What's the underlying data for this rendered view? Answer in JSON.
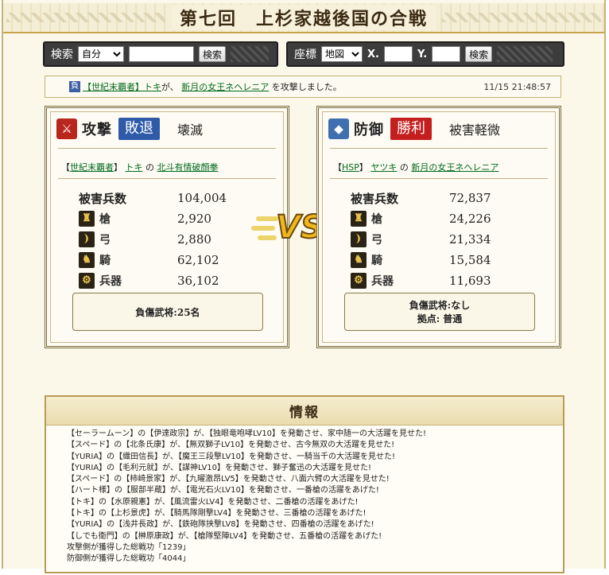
{
  "title": "第七回　上杉家越後国の合戦",
  "search": {
    "label": "検索",
    "select_value": "自分",
    "input_value": "",
    "button": "検索"
  },
  "coord": {
    "label": "座標",
    "select_value": "地図",
    "x_label": "X.",
    "y_label": "Y.",
    "x_value": "",
    "y_value": "",
    "button": "検索"
  },
  "log": {
    "badge": "負",
    "alliance": "【世紀末覇者】",
    "player": "トキ",
    "particle1": "が、",
    "target": "新月の女王ネヘレニア",
    "tail": "を攻撃しました。",
    "timestamp": "11/15 21:48:57"
  },
  "attack": {
    "icon": "⚔",
    "role": "攻撃",
    "result": "敗退",
    "damage": "壊滅",
    "alliance_open": "【",
    "alliance": "世紀末覇者",
    "alliance_close": "】",
    "player": "トキ",
    "particle": "の",
    "general": "北斗有情破顔拳",
    "total_label": "被害兵数",
    "total": "104,004",
    "units": [
      {
        "name": "槍",
        "icon": "spear-icon",
        "value": "2,920"
      },
      {
        "name": "弓",
        "icon": "bow-icon",
        "value": "2,880"
      },
      {
        "name": "騎",
        "icon": "horse-icon",
        "value": "62,102"
      },
      {
        "name": "兵器",
        "icon": "siege-weapon-icon",
        "value": "36,102"
      }
    ],
    "injured": "負傷武将:25名",
    "base": ""
  },
  "defense": {
    "icon": "◆",
    "role": "防御",
    "result": "勝利",
    "damage": "被害軽微",
    "alliance_open": "【",
    "alliance": "HSP",
    "alliance_close": "】",
    "player": "ヤツキ",
    "particle": "の",
    "general": "新月の女王ネヘレニア",
    "total_label": "被害兵数",
    "total": "72,837",
    "units": [
      {
        "name": "槍",
        "icon": "spear-icon",
        "value": "24,226"
      },
      {
        "name": "弓",
        "icon": "bow-icon",
        "value": "21,334"
      },
      {
        "name": "騎",
        "icon": "horse-icon",
        "value": "15,584"
      },
      {
        "name": "兵器",
        "icon": "siege-weapon-icon",
        "value": "11,693"
      }
    ],
    "injured": "負傷武将:なし",
    "base": "拠点: 普通"
  },
  "vs": "VS",
  "info": {
    "title": "情報",
    "lines": [
      "【セーラームーン】の【伊達政宗】が、【独眼竜咆哮LV10】を発動させ、家中随一の大活躍を見せた!",
      "【スペード】の【北条氏康】が、【無双獅子LV10】を発動させ、古今無双の大活躍を見せた!",
      "【YURIA】の【織田信長】が、【魔王三段撃LV10】を発動させ、一騎当千の大活躍を見せた!",
      "【YURIA】の【毛利元就】が、【謀神LV10】を発動させ、獅子奮迅の大活躍を見せた!",
      "【スペード】の【柿崎景家】が、【九曜激昂LV5】を発動させ、八面六臂の大活躍を見せた!",
      "【ハート様】の【服部半蔵】が、【電光石火LV10】を発動させ、一番槍の活躍をあげた!",
      "【トキ】の【水原親憲】が、【風流雷火LV4】を発動させ、二番槍の活躍をあげた!",
      "【トキ】の【上杉景虎】が、【騎馬隊剛撃LV4】を発動させ、三番槍の活躍をあげた!",
      "【YURIA】の【浅井長政】が、【鉄砲隊挟撃LV8】を発動させ、四番槍の活躍をあげた!",
      "【しでも衛門】の【榊原康政】が、【槍隊堅陣LV4】を発動させ、五番槍の活躍をあげた!",
      "攻撃側が獲得した総戦功「1239」",
      "防御側が獲得した総戦功「4044」"
    ]
  },
  "colors": {
    "attack_result": "#2e5aa8",
    "defense_result": "#c41e1e",
    "link": "#006a1f",
    "frame": "#7a6a3a"
  }
}
